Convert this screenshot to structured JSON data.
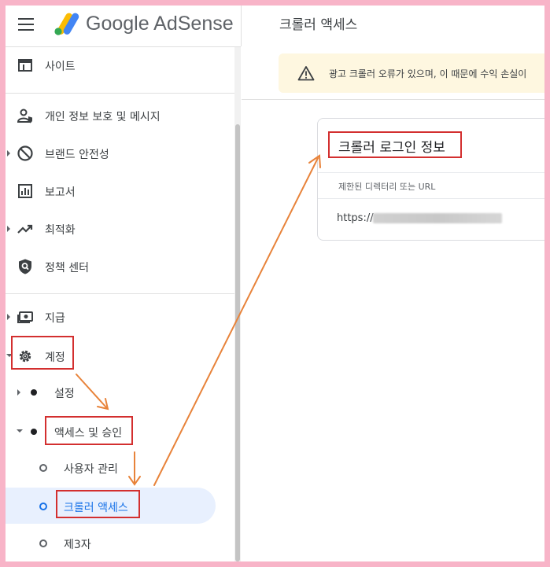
{
  "header": {
    "logo_text": "Google AdSense",
    "page_title": "크롤러 액세스"
  },
  "sidebar": {
    "items": [
      {
        "label": "사이트",
        "icon": "site-icon"
      },
      {
        "label": "개인 정보 보호 및 메시지",
        "icon": "privacy-icon"
      },
      {
        "label": "브랜드 안전성",
        "icon": "block-icon"
      },
      {
        "label": "보고서",
        "icon": "report-icon"
      },
      {
        "label": "최적화",
        "icon": "trending-icon"
      },
      {
        "label": "정책 센터",
        "icon": "policy-shield-icon"
      },
      {
        "label": "지급",
        "icon": "payments-icon"
      },
      {
        "label": "계정",
        "icon": "gear-icon"
      }
    ],
    "sub_items": [
      {
        "label": "설정"
      },
      {
        "label": "액세스 및 승인"
      }
    ],
    "sub_sub_items": [
      {
        "label": "사용자 관리"
      },
      {
        "label": "크롤러 액세스"
      },
      {
        "label": "제3자"
      }
    ]
  },
  "content": {
    "warning_text": "광고 크롤러 오류가 있으며, 이 때문에 수익 손실이",
    "card": {
      "title": "크롤러 로그인 정보",
      "column_header": "제한된 디렉터리 또는 URL",
      "url_prefix": "https://"
    }
  },
  "colors": {
    "annotation_box": "#d32f2f",
    "annotation_arrow": "#e8833a",
    "frame": "#f8b4c8",
    "active_bg": "#e8f0fe",
    "warning_bg": "#fef7e0"
  }
}
